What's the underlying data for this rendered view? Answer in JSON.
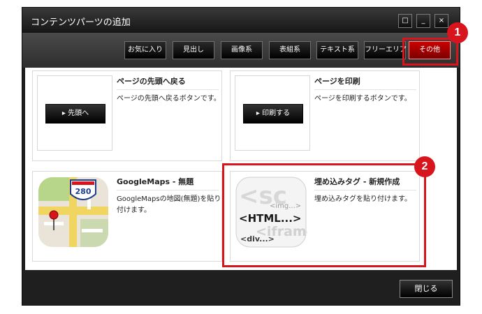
{
  "window": {
    "title": "コンテンツパーツの追加",
    "maximize_glyph": "□",
    "minimize_glyph": "_",
    "close_glyph": "×"
  },
  "tabs": [
    {
      "label": "お気に入り",
      "active": false
    },
    {
      "label": "見出し",
      "active": false
    },
    {
      "label": "画像系",
      "active": false
    },
    {
      "label": "表組系",
      "active": false
    },
    {
      "label": "テキスト系",
      "active": false
    },
    {
      "label": "フリーエリア",
      "active": false
    },
    {
      "label": "その他",
      "active": true
    }
  ],
  "cards": [
    {
      "title": "ページの先頭へ戻る",
      "description": "ページの先頭へ戻るボタンです。",
      "preview_button": "▸ 先頭へ"
    },
    {
      "title": "ページを印刷",
      "description": "ページを印刷するボタンです。",
      "preview_button": "▸ 印刷する"
    },
    {
      "title": "GoogleMaps - 無題",
      "description": "GoogleMapsの地図(無題)を貼り付けます。",
      "icon": "map-icon",
      "icon_text": "280"
    },
    {
      "title": "埋め込みタグ - 新規作成",
      "description": "埋め込みタグを貼り付けます。",
      "icon": "embed-tag-icon",
      "icon_texts": {
        "big": "<sc",
        "img": "<img...>",
        "html": "<HTML...>",
        "iframe": "<iframe",
        "div": "<div...>"
      }
    }
  ],
  "annotations": {
    "badge_1": "1",
    "badge_2": "2",
    "color": "#d8141c"
  },
  "footer": {
    "close_label": "閉じる"
  }
}
